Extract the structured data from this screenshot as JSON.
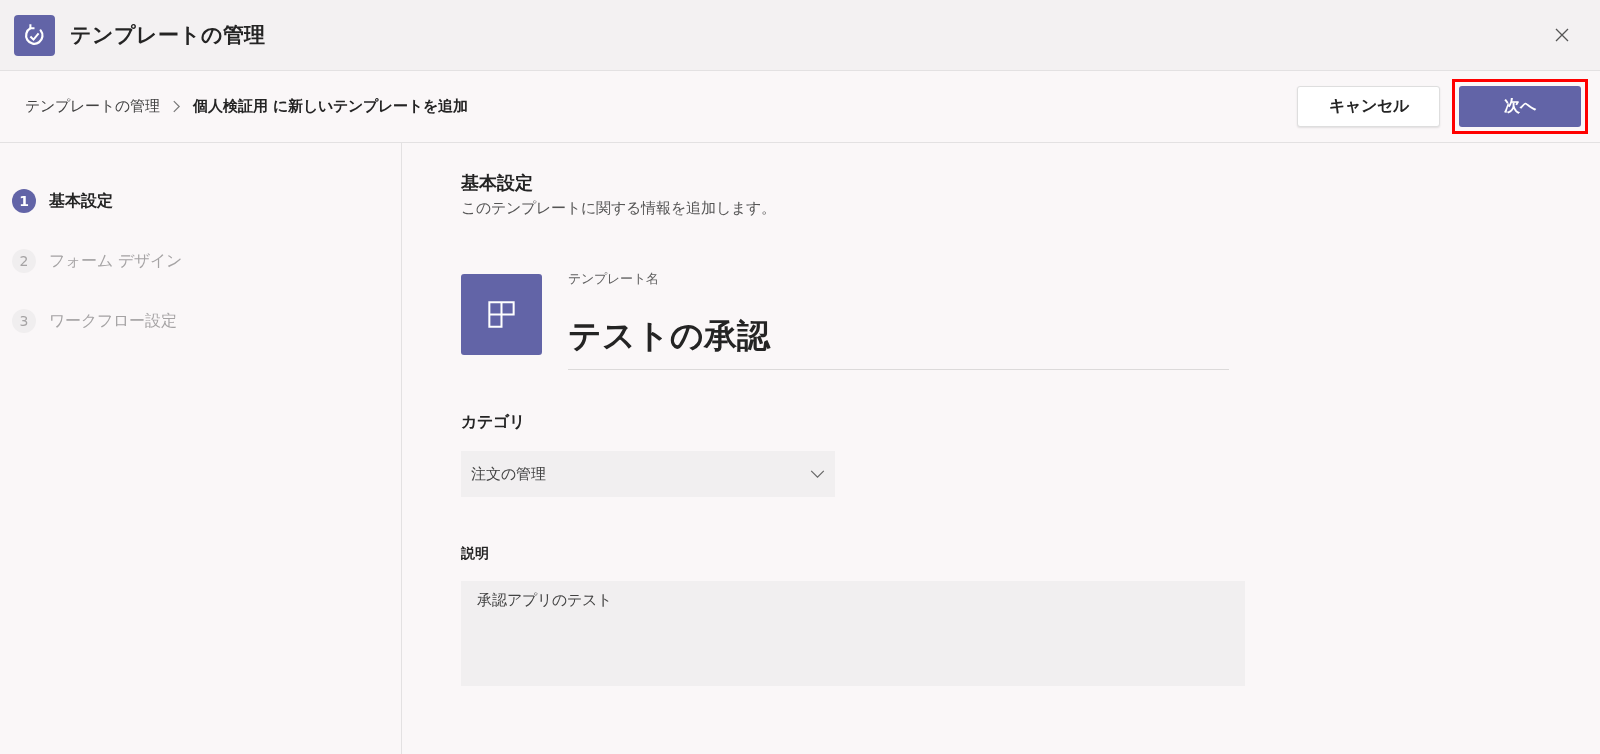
{
  "window": {
    "title": "テンプレートの管理"
  },
  "breadcrumb": [
    {
      "label": "テンプレートの管理",
      "current": false
    },
    {
      "label": "個人検証用 に新しいテンプレートを追加",
      "current": true
    }
  ],
  "buttons": [
    {
      "label": "キャンセル",
      "kind": "secondary",
      "highlighted": false
    },
    {
      "label": "次へ",
      "kind": "primary",
      "highlighted": true
    }
  ],
  "steps": [
    {
      "number": "1",
      "label": "基本設定",
      "selected": true
    },
    {
      "number": "2",
      "label": "フォーム デザイン",
      "selected": false
    },
    {
      "number": "3",
      "label": "ワークフロー設定",
      "selected": false
    }
  ],
  "section": {
    "title": "基本設定",
    "subtitle": "このテンプレートに関する情報を追加します。"
  },
  "template_name": {
    "label": "テンプレート名",
    "value": "テストの承認"
  },
  "category": {
    "label": "カテゴリ",
    "value": "注文の管理"
  },
  "description": {
    "label": "説明",
    "value": "承認アプリのテスト"
  }
}
